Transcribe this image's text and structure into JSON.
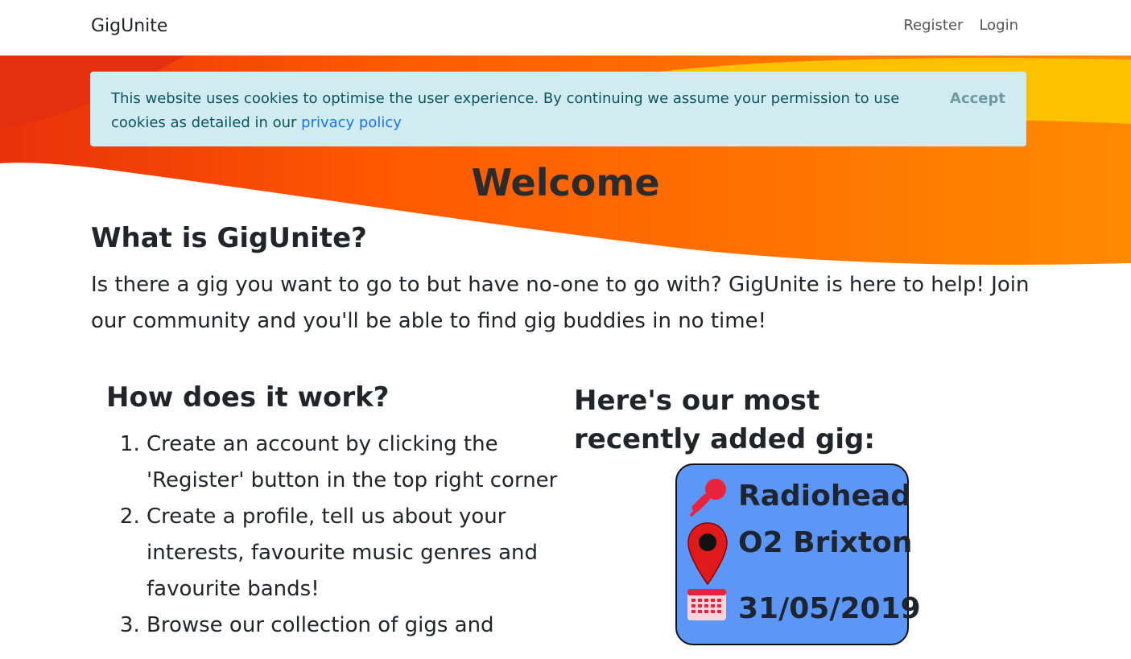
{
  "navbar": {
    "brand": "GigUnite",
    "links": {
      "register": "Register",
      "login": "Login"
    }
  },
  "cookie": {
    "text": "This website uses cookies to optimise the user experience. By continuing we assume your permission to use cookies as detailed in our",
    "link": "privacy policy",
    "accept": "Accept"
  },
  "hero": {
    "welcome": "Welcome",
    "what_title": "What is GigUnite?",
    "intro": "Is there a gig you want to go to but have no-one to go with? GigUnite is here to help! Join our community and you'll be able to find gig buddies in no time!"
  },
  "how": {
    "title": "How does it work?",
    "steps": [
      "Create an account by clicking the 'Register' button in the top right corner",
      "Create a profile, tell us about your interests, favourite music genres and favourite bands!",
      "Browse our collection of gigs and"
    ]
  },
  "recent": {
    "title": "Here's our most recently added gig:",
    "gig": {
      "artist": "Radiohead",
      "venue": "O2 Brixton",
      "date": "31/05/2019"
    }
  },
  "colors": {
    "cookie_bg": "#d1ecf1",
    "card_bg": "#5c97f7",
    "wave_red": "#ee3a0a",
    "wave_orange": "#fe7a00",
    "wave_yellow": "#fdc100"
  },
  "icons": {
    "artist": "microphone-icon",
    "venue": "map-pin-icon",
    "date": "calendar-icon"
  }
}
